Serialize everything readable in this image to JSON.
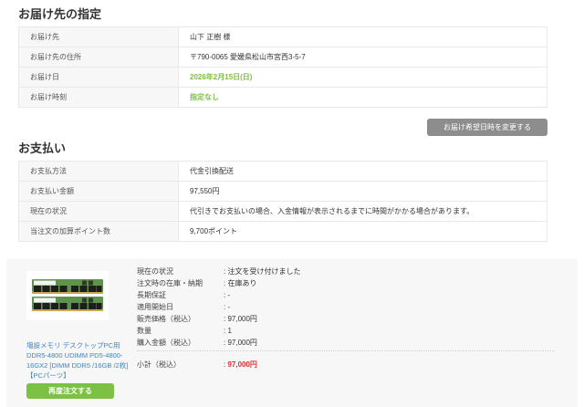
{
  "delivery": {
    "title": "お届け先の指定",
    "rows": [
      {
        "label": "お届け先",
        "value": "山下 正樹 様"
      },
      {
        "label": "お届け先の住所",
        "value": "〒790-0065 愛媛県松山市宮西3-5-7"
      },
      {
        "label": "お届け日",
        "value": "2026年2月15日(日)"
      },
      {
        "label": "お届け時刻",
        "value": "指定なし"
      }
    ],
    "change_button": "お届け希望日時を変更する"
  },
  "payment": {
    "title": "お支払い",
    "rows": [
      {
        "label": "お支払方法",
        "value": "代金引換配送"
      },
      {
        "label": "お支払い金額",
        "value": "97,550円"
      },
      {
        "label": "現在の状況",
        "value": "代引きでお支払いの場合、入金情報が表示されるまでに時間がかかる場合があります。"
      },
      {
        "label": "当注文の加算ポイント数",
        "value": "9,700ポイント"
      }
    ]
  },
  "order_item": {
    "image_name": "ram-memory-modules-photo",
    "product_title": "増設メモリ デスクトップPC用 DDR5-4800 UDIMM PD5-4800-16GX2 [DIMM DDR5 /16GB /2枚] 【PCパーツ】",
    "reorder_button": "再度注文する",
    "details": [
      {
        "label": "現在の状況",
        "value": "注文を受け付けました"
      },
      {
        "label": "注文時の在庫・納期",
        "value": "在庫あり"
      },
      {
        "label": "長期保証",
        "value": "-"
      },
      {
        "label": "適用開始日",
        "value": "-"
      },
      {
        "label": "販売価格（税込）",
        "value": "97,000円"
      },
      {
        "label": "数量",
        "value": "1"
      },
      {
        "label": "購入金額（税込）",
        "value": "97,000円"
      }
    ],
    "subtotal": {
      "label": "小計（税込）",
      "value": "97,000円"
    }
  },
  "colors": {
    "accent_green": "#7cc143",
    "link_blue": "#4383c4",
    "price_red": "#e03232",
    "button_gray": "#8d8d8d",
    "panel_gray": "#f7f7f7"
  }
}
